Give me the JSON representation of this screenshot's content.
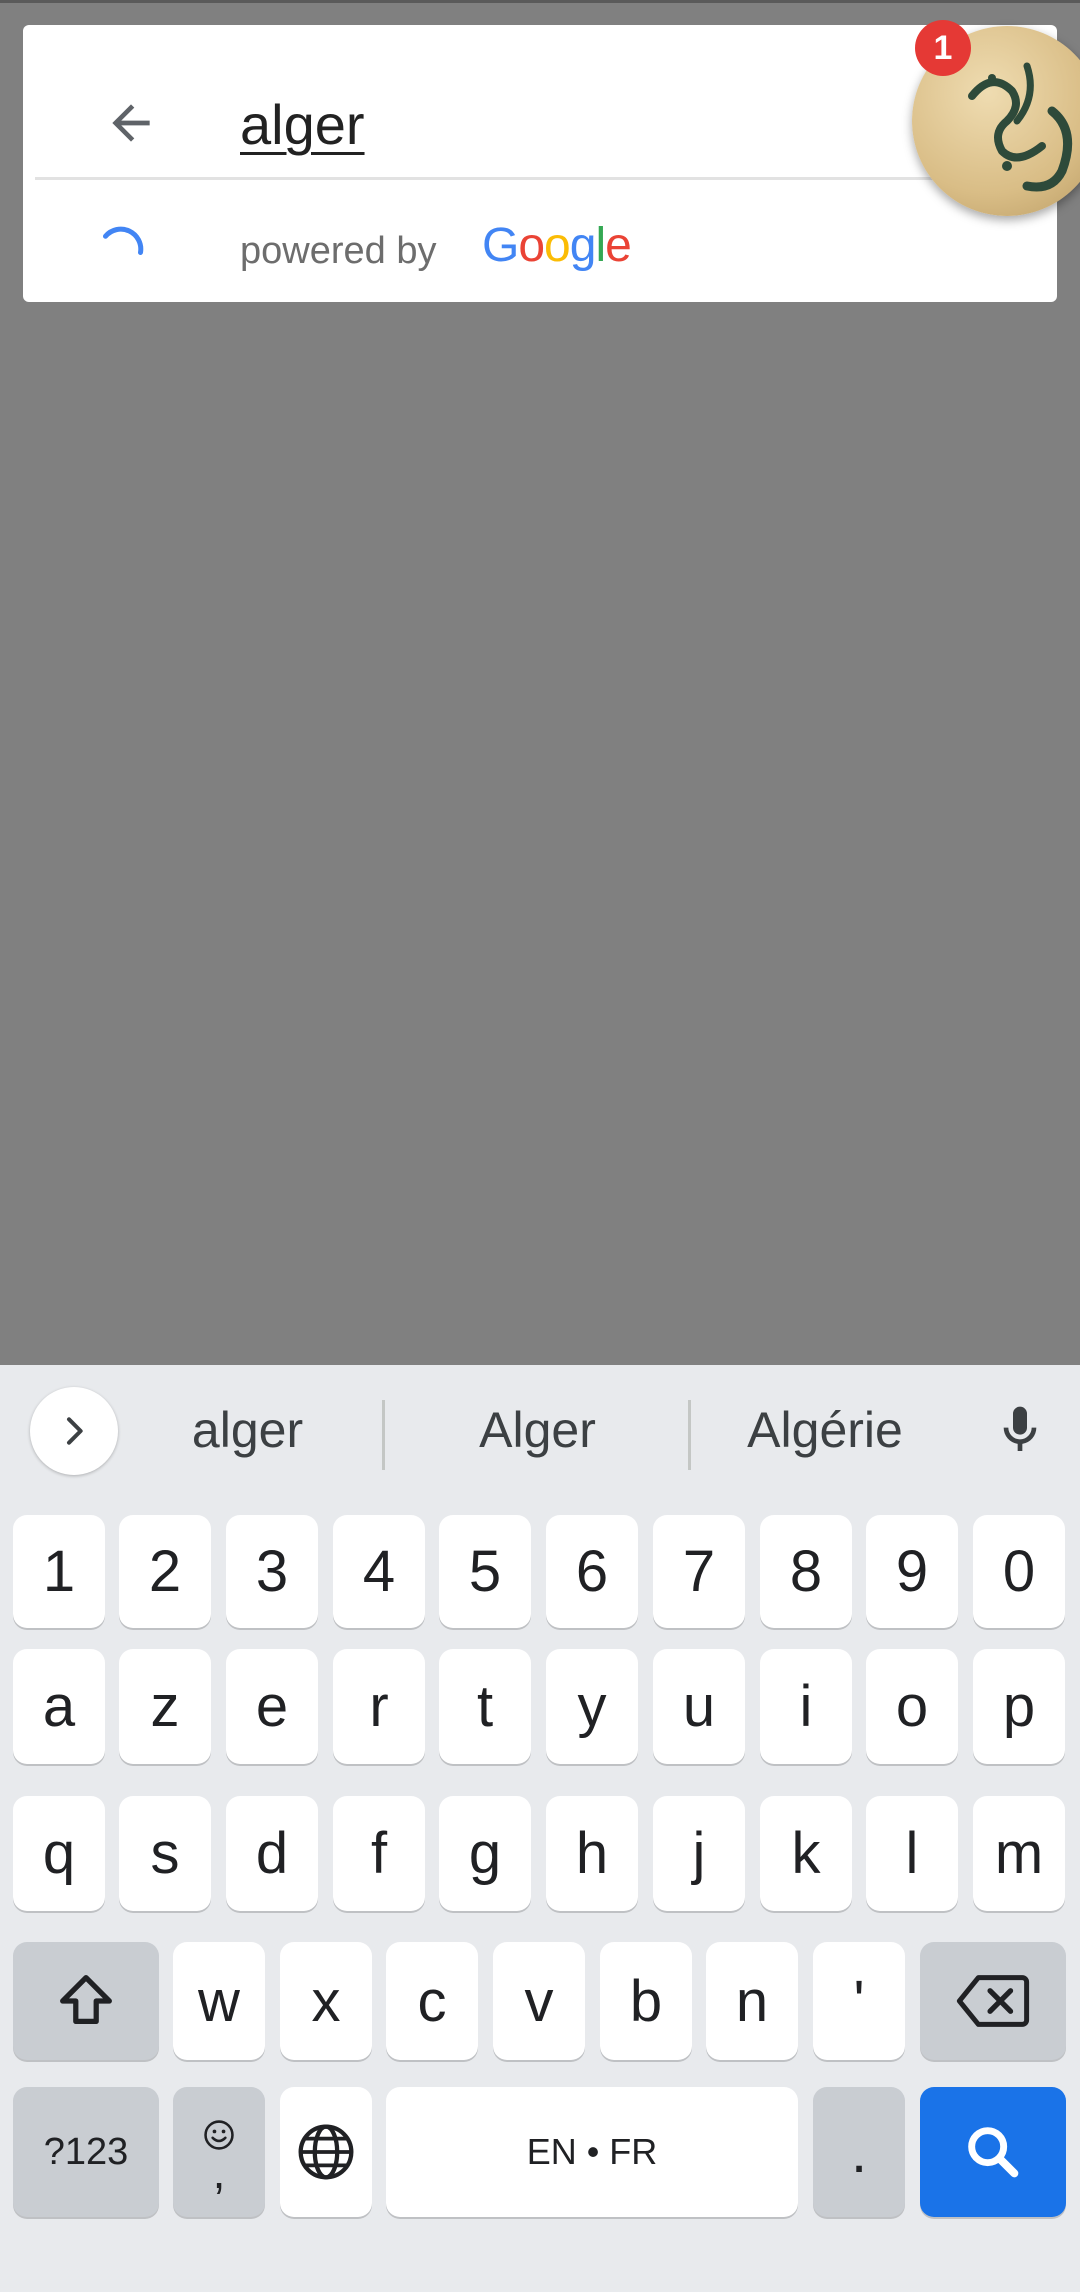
{
  "search": {
    "query": "alger",
    "powered_by": "powered by",
    "brand": [
      "G",
      "o",
      "o",
      "g",
      "l",
      "e"
    ]
  },
  "chat_head": {
    "badge_count": "1"
  },
  "keyboard": {
    "suggestions": [
      "alger",
      "Alger",
      "Algérie"
    ],
    "row_numbers": [
      "1",
      "2",
      "3",
      "4",
      "5",
      "6",
      "7",
      "8",
      "9",
      "0"
    ],
    "row1": [
      "a",
      "z",
      "e",
      "r",
      "t",
      "y",
      "u",
      "i",
      "o",
      "p"
    ],
    "row2": [
      "q",
      "s",
      "d",
      "f",
      "g",
      "h",
      "j",
      "k",
      "l",
      "m"
    ],
    "row3": [
      "w",
      "x",
      "c",
      "v",
      "b",
      "n",
      "'"
    ],
    "symbols_key": "?123",
    "emoji_comma_key": ",",
    "space_label": "EN • FR",
    "period_key": "."
  },
  "colors": {
    "google_blue": "#4285F4",
    "google_red": "#EA4335",
    "google_yellow": "#FBBC05",
    "google_green": "#34A853",
    "enter_key": "#1a73e8",
    "badge": "#e53935"
  },
  "icons": [
    "arrow-back-icon",
    "loading-spinner-icon",
    "chevron-right-icon",
    "microphone-icon",
    "shift-icon",
    "backspace-icon",
    "emoji-icon",
    "globe-icon",
    "search-icon"
  ]
}
